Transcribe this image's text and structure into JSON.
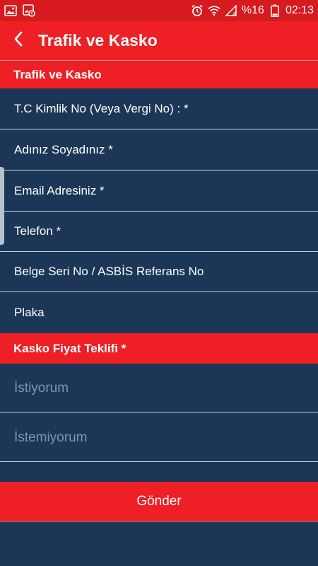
{
  "status_bar": {
    "battery_percent": "%16",
    "time": "02:13",
    "icons": [
      "image-icon",
      "cast-image-icon",
      "alarm-icon",
      "wifi-icon",
      "signal-icon",
      "battery-icon"
    ]
  },
  "app_bar": {
    "title": "Trafik ve Kasko",
    "back_icon": "chevron-left-icon"
  },
  "form": {
    "section_title": "Trafik ve Kasko",
    "fields": {
      "tc_kimlik": "T.C Kimlik No (Veya Vergi No) : *",
      "ad_soyad": "Adınız Soyadınız *",
      "email": "Email Adresiniz *",
      "telefon": "Telefon *",
      "belge": "Belge Seri No / ASBİS Referans No",
      "plaka": "Plaka"
    },
    "kasko_section_title": "Kasko Fiyat Teklifi *",
    "kasko_options": [
      "İstiyorum",
      "İstemiyorum"
    ],
    "submit_label": "Gönder"
  },
  "colors": {
    "accent_red": "#ee1f25",
    "status_red": "#d61a1f",
    "background_navy": "#1b3656",
    "placeholder_gray": "#8393a8"
  }
}
